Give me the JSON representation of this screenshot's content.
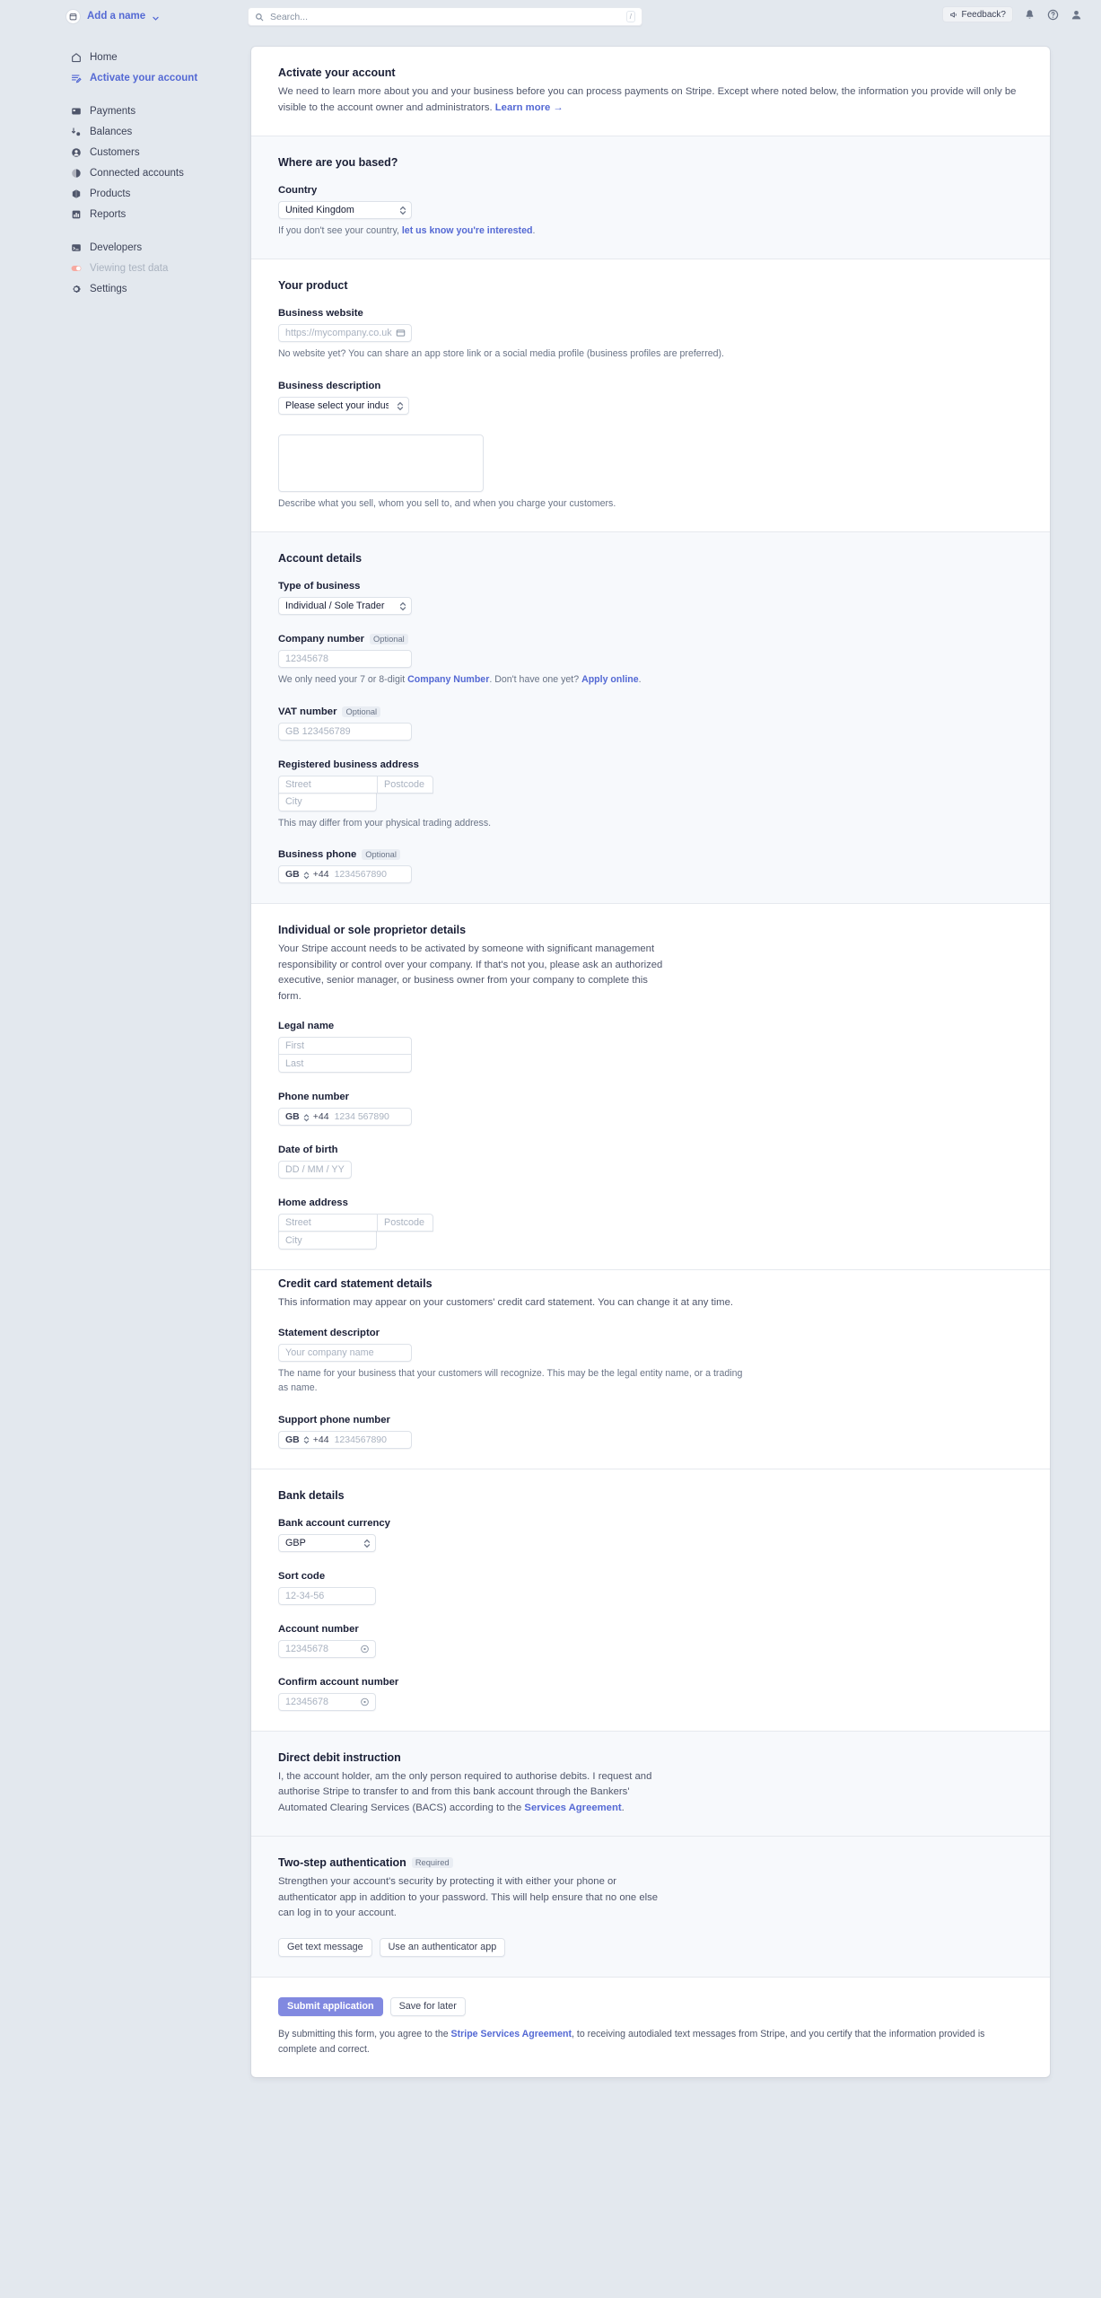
{
  "topbar": {
    "account_name": "Add a name",
    "account_icon": "calendar-icon",
    "chevron_icon": "chevron-down-icon",
    "search": {
      "placeholder": "Search...",
      "value": "",
      "shortcut": "/",
      "icon": "search-icon"
    },
    "feedback_label": "Feedback?",
    "feedback_icon": "megaphone-icon",
    "notifications_icon": "bell-icon",
    "help_icon": "question-circle-icon",
    "account_icon_right": "user-avatar-icon"
  },
  "sidebar": {
    "groups": [
      {
        "items": [
          {
            "label": "Home",
            "icon": "home-icon",
            "state": "default"
          },
          {
            "label": "Activate your account",
            "icon": "activate-icon",
            "state": "active"
          }
        ]
      },
      {
        "items": [
          {
            "label": "Payments",
            "icon": "payments-icon",
            "state": "default"
          },
          {
            "label": "Balances",
            "icon": "balances-icon",
            "state": "default"
          },
          {
            "label": "Customers",
            "icon": "customers-icon",
            "state": "default"
          },
          {
            "label": "Connected accounts",
            "icon": "connected-accounts-icon",
            "state": "default"
          },
          {
            "label": "Products",
            "icon": "products-icon",
            "state": "default"
          },
          {
            "label": "Reports",
            "icon": "reports-icon",
            "state": "default"
          }
        ]
      },
      {
        "items": [
          {
            "label": "Developers",
            "icon": "developers-icon",
            "state": "default"
          },
          {
            "label": "Viewing test data",
            "icon": "test-data-toggle-icon",
            "state": "dim"
          },
          {
            "label": "Settings",
            "icon": "gear-icon",
            "state": "default"
          }
        ]
      }
    ]
  },
  "intro": {
    "title": "Activate your account",
    "body_1": "We need to learn more about you and your business before you can process payments on Stripe. Except where noted below, the information you provide will only be visible to the account owner and administrators. ",
    "learn_more": "Learn more →"
  },
  "based": {
    "title": "Where are you based?",
    "country_label": "Country",
    "country_value": "United Kingdom",
    "hint_prefix": "If you don't see your country, ",
    "hint_link": "let us know you're interested",
    "hint_suffix": "."
  },
  "product": {
    "title": "Your product",
    "website_label": "Business website",
    "website_placeholder": "https://mycompany.co.uk",
    "website_value": "",
    "website_trailing_icon": "card-icon",
    "website_hint": "No website yet? You can share an app store link or a social media profile (business profiles are preferred).",
    "description_label": "Business description",
    "industry_value": "Please select your industry...",
    "description_value": "",
    "description_hint": "Describe what you sell, whom you sell to, and when you charge your customers."
  },
  "account_details": {
    "title": "Account details",
    "type_label": "Type of business",
    "type_value": "Individual / Sole Trader",
    "company_number_label": "Company number",
    "company_number_tag": "Optional",
    "company_number_placeholder": "12345678",
    "company_number_value": "",
    "company_hint_1": "We only need your 7 or 8-digit ",
    "company_hint_link_1": "Company Number",
    "company_hint_2": ". Don't have one yet? ",
    "company_hint_link_2": "Apply online",
    "company_hint_3": ".",
    "vat_label": "VAT number",
    "vat_tag": "Optional",
    "vat_placeholder": "GB 123456789",
    "vat_value": "",
    "address_label": "Registered business address",
    "street_placeholder": "Street",
    "street_value": "",
    "postcode_placeholder": "Postcode",
    "postcode_value": "",
    "city_placeholder": "City",
    "city_value": "",
    "address_hint": "This may differ from your physical trading address.",
    "phone_label": "Business phone",
    "phone_tag": "Optional",
    "phone_country": "GB",
    "phone_prefix": "+44",
    "phone_placeholder": "1234567890",
    "phone_value": ""
  },
  "individual": {
    "title": "Individual or sole proprietor details",
    "body": "Your Stripe account needs to be activated by someone with significant management responsibility or control over your company. If that's not you, please ask an authorized executive, senior manager, or business owner from your company to complete this form.",
    "legal_name_label": "Legal name",
    "first_placeholder": "First",
    "first_value": "",
    "last_placeholder": "Last",
    "last_value": "",
    "phone_label": "Phone number",
    "phone_country": "GB",
    "phone_prefix": "+44",
    "phone_placeholder": "1234 567890",
    "phone_value": "",
    "dob_label": "Date of birth",
    "dob_placeholder": "DD / MM / YYYY",
    "dob_value": "",
    "home_label": "Home address",
    "street_placeholder": "Street",
    "street_value": "",
    "postcode_placeholder": "Postcode",
    "postcode_value": "",
    "city_placeholder": "City",
    "city_value": ""
  },
  "statement": {
    "title": "Credit card statement details",
    "body": "This information may appear on your customers' credit card statement. You can change it at any time.",
    "descriptor_label": "Statement descriptor",
    "descriptor_placeholder": "Your company name",
    "descriptor_value": "",
    "descriptor_hint": "The name for your business that your customers will recognize. This may be the legal entity name, or a trading as name.",
    "support_phone_label": "Support phone number",
    "phone_country": "GB",
    "phone_prefix": "+44",
    "phone_placeholder": "1234567890",
    "phone_value": ""
  },
  "bank": {
    "title": "Bank details",
    "currency_label": "Bank account currency",
    "currency_value": "GBP",
    "sort_code_label": "Sort code",
    "sort_code_placeholder": "12-34-56",
    "sort_code_value": "",
    "account_number_label": "Account number",
    "account_number_placeholder": "12345678",
    "account_number_value": "",
    "account_number_icon": "eye-icon",
    "confirm_label": "Confirm account number",
    "confirm_placeholder": "12345678",
    "confirm_value": "",
    "confirm_icon": "eye-icon"
  },
  "direct_debit": {
    "title": "Direct debit instruction",
    "body_1": "I, the account holder, am the only person required to authorise debits. I request and authorise Stripe to transfer to and from this bank account through the Bankers' Automated Clearing Services (BACS) according to the ",
    "link": "Services Agreement",
    "body_2": "."
  },
  "two_step": {
    "title": "Two-step authentication",
    "tag": "Required",
    "body": "Strengthen your account's security by protecting it with either your phone or authenticator app in addition to your password. This will help ensure that no one else can log in to your account.",
    "sms_button": "Get text message",
    "app_button": "Use an authenticator app"
  },
  "submit": {
    "primary": "Submit application",
    "secondary": "Save for later",
    "note_1": "By submitting this form, you agree to the ",
    "note_link": "Stripe Services Agreement",
    "note_2": ", to receiving autodialed text messages from Stripe, and you certify that the information provided is complete and correct."
  },
  "colors": {
    "accent": "#5469d4",
    "primary_button": "#8189e0",
    "page_bg": "#e3e8ee"
  }
}
